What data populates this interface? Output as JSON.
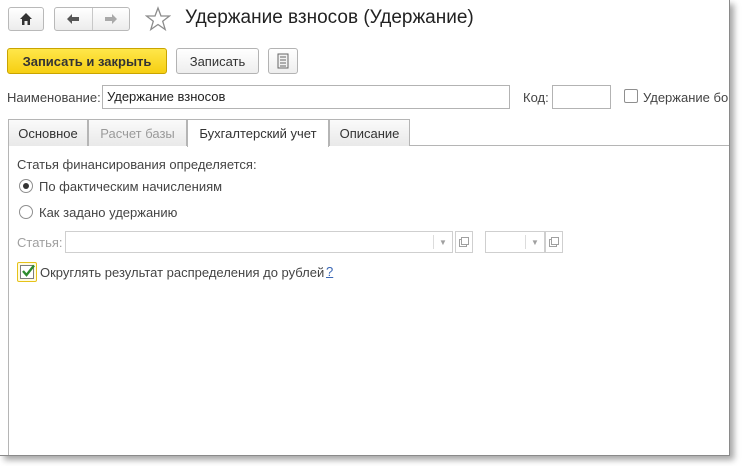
{
  "window": {
    "title": "Удержание взносов (Удержание)"
  },
  "toolbar": {
    "save_close_label": "Записать и закрыть",
    "save_label": "Записать"
  },
  "header": {
    "name_label": "Наименование:",
    "name_value": "Удержание взносов",
    "code_label": "Код:",
    "code_value": "",
    "extra_checkbox_label": "Удержание бо"
  },
  "tabs": [
    {
      "label": "Основное",
      "state": "normal"
    },
    {
      "label": "Расчет базы",
      "state": "disabled"
    },
    {
      "label": "Бухгалтерский учет",
      "state": "active"
    },
    {
      "label": "Описание",
      "state": "normal"
    }
  ],
  "accounting": {
    "section_label": "Статья финансирования определяется:",
    "options": [
      {
        "label": "По фактическим начислениям",
        "selected": true
      },
      {
        "label": "Как задано удержанию",
        "selected": false
      }
    ],
    "article_label": "Статья:",
    "article_value": "",
    "round_checkbox_label": "Округлять результат распределения до рублей",
    "round_checked": true,
    "help_label": "?"
  },
  "icons": {
    "home": "home-icon",
    "back": "arrow-left-icon",
    "forward": "arrow-right-icon",
    "favorite": "star-icon",
    "more": "document-list-icon",
    "dropdown": "chevron-down-icon",
    "open": "open-form-icon",
    "check": "checkmark-icon"
  },
  "colors": {
    "primary_button": "#f6cf12",
    "checkmark": "#2e8b2e",
    "help_link": "#3a67b5"
  }
}
